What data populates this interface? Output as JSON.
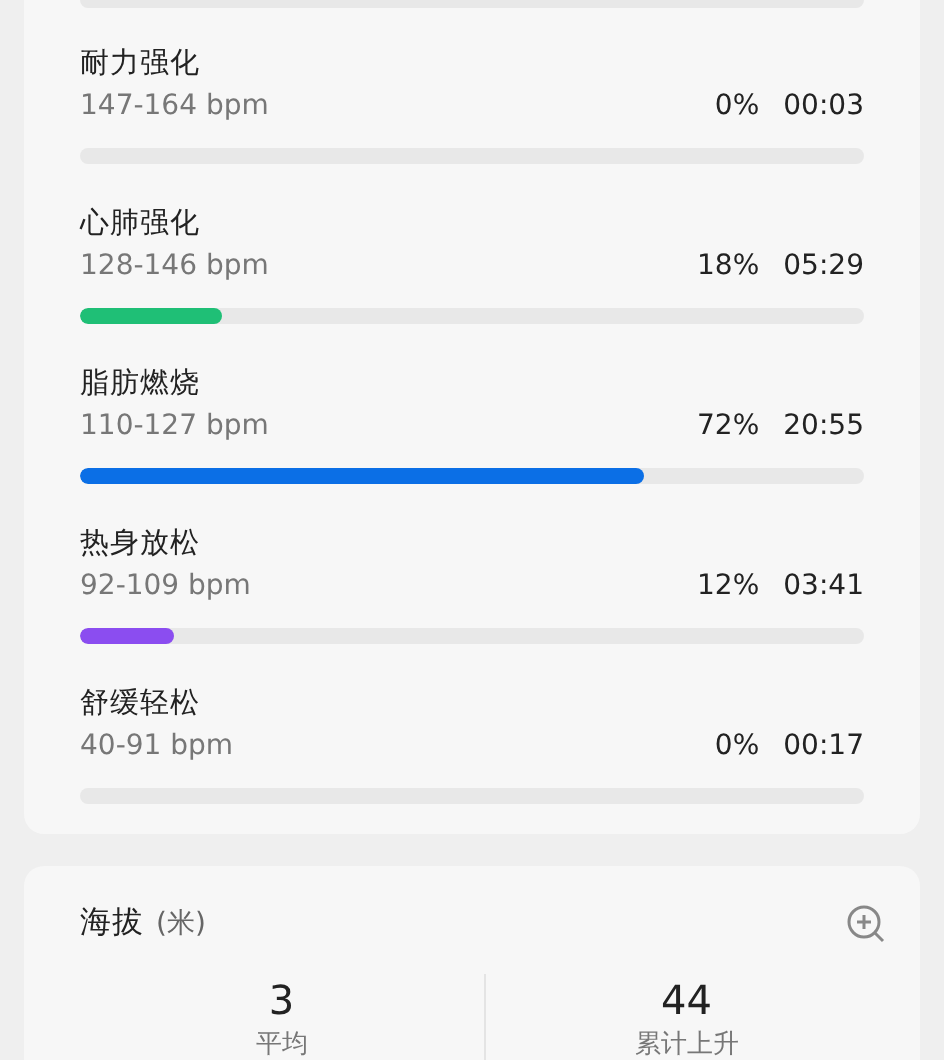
{
  "zones": [
    {
      "name": "耐力强化",
      "range": "147-164 bpm",
      "percent": "0%",
      "time": "00:03"
    },
    {
      "name": "心肺强化",
      "range": "128-146 bpm",
      "percent": "18%",
      "time": "05:29",
      "level": 0.18,
      "color": "#1fbf76"
    },
    {
      "name": "脂肪燃烧",
      "range": "110-127 bpm",
      "percent": "72%",
      "time": "20:55",
      "level": 0.72,
      "color": "#0b6fe6"
    },
    {
      "name": "热身放松",
      "range": "92-109 bpm",
      "percent": "12%",
      "time": "03:41",
      "level": 0.12,
      "color": "#8b4df0"
    },
    {
      "name": "舒缓轻松",
      "range": "40-91 bpm",
      "percent": "0%",
      "time": "00:17"
    }
  ],
  "altitude": {
    "title": "海拔",
    "unit": "(米)",
    "stats": [
      {
        "value": "3",
        "label": "平均"
      },
      {
        "value": "44",
        "label": "累计上升"
      }
    ]
  }
}
